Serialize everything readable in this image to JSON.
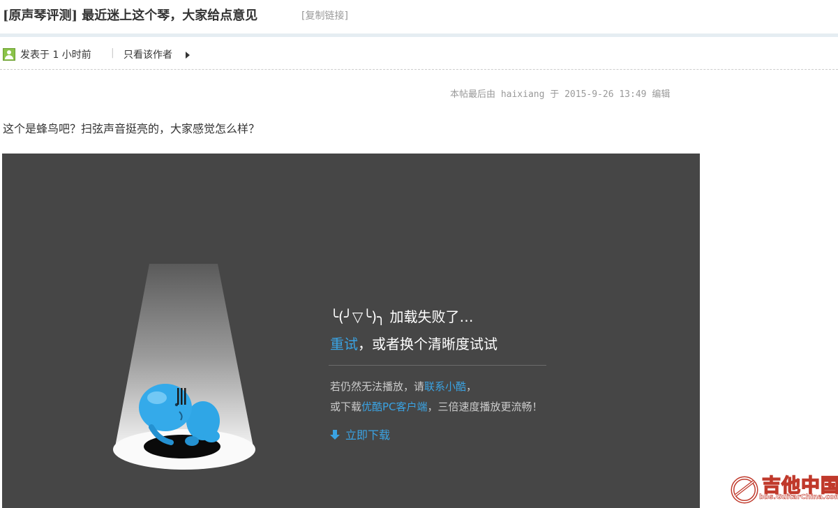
{
  "thread": {
    "title": "[原声琴评测] 最近迷上这个琴，大家给点意见",
    "copy_link": "[复制链接]"
  },
  "meta": {
    "posted": "发表于 1 小时前",
    "separator": "|",
    "author_only": "只看该作者"
  },
  "post": {
    "edit_note": "本帖最后由 haixiang 于 2015-9-26 13:49 编辑",
    "text": "这个是蜂鸟吧？扫弦声音挺亮的，大家感觉怎么样？"
  },
  "player": {
    "error_title": "╰(╯▽╰)╮ 加载失败了…",
    "retry": "重试",
    "retry_suffix": "，或者换个清晰度试试",
    "hint1_prefix": "若仍然无法播放，请",
    "hint1_link": "联系小酷",
    "hint1_suffix": "，",
    "hint2_prefix": "或下载",
    "hint2_link": "优酷PC客户端",
    "hint2_suffix": "，三倍速度播放更流畅！",
    "download": "立即下载",
    "colors": {
      "background": "#464646",
      "link": "#3aa3e3",
      "mascot": "#2fa6e6"
    }
  },
  "watermark": {
    "brand": "吉他中国",
    "url": "bbs.GuitarChina.com"
  }
}
